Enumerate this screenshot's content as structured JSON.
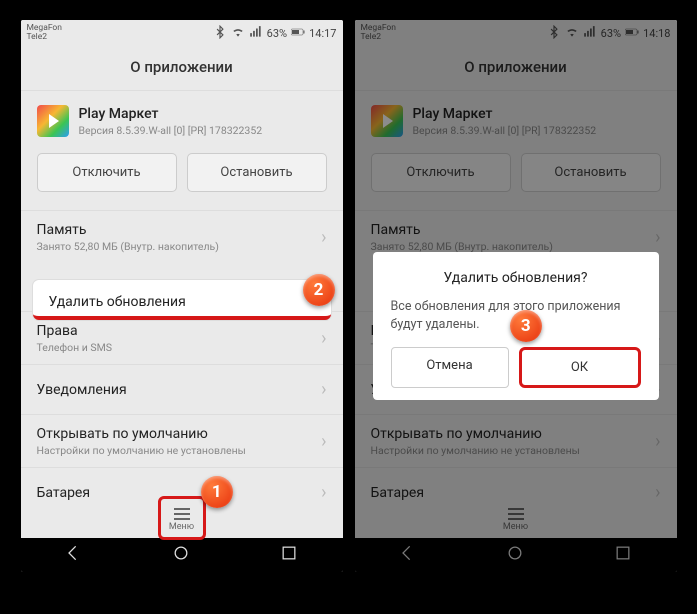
{
  "statusbar": {
    "carrier1": "MegaFon",
    "carrier2": "Tele2",
    "battery": "63%",
    "time": "14:17",
    "time2": "14:18"
  },
  "title": "О приложении",
  "app": {
    "name": "Play Маркет",
    "version": "Версия 8.5.39.W-all [0] [PR] 178322352"
  },
  "buttons": {
    "disable": "Отключить",
    "stop": "Остановить"
  },
  "list": {
    "memory_title": "Память",
    "memory_sub": "Занято 52,80 МБ (Внутр. накопитель)",
    "perms_title": "Права",
    "perms_sub": "Телефон и SMS",
    "notif_title": "Уведомления",
    "default_title": "Открывать по умолчанию",
    "default_sub": "Настройки по умолчанию не установлены",
    "battery_title": "Батарея"
  },
  "popup": {
    "delete_updates": "Удалить обновления"
  },
  "menu_label": "Меню",
  "dialog": {
    "title": "Удалить обновления?",
    "text": "Все обновления для этого приложения будут удалены.",
    "cancel": "Отмена",
    "ok": "ОК"
  },
  "badges": {
    "b1": "1",
    "b2": "2",
    "b3": "3"
  }
}
